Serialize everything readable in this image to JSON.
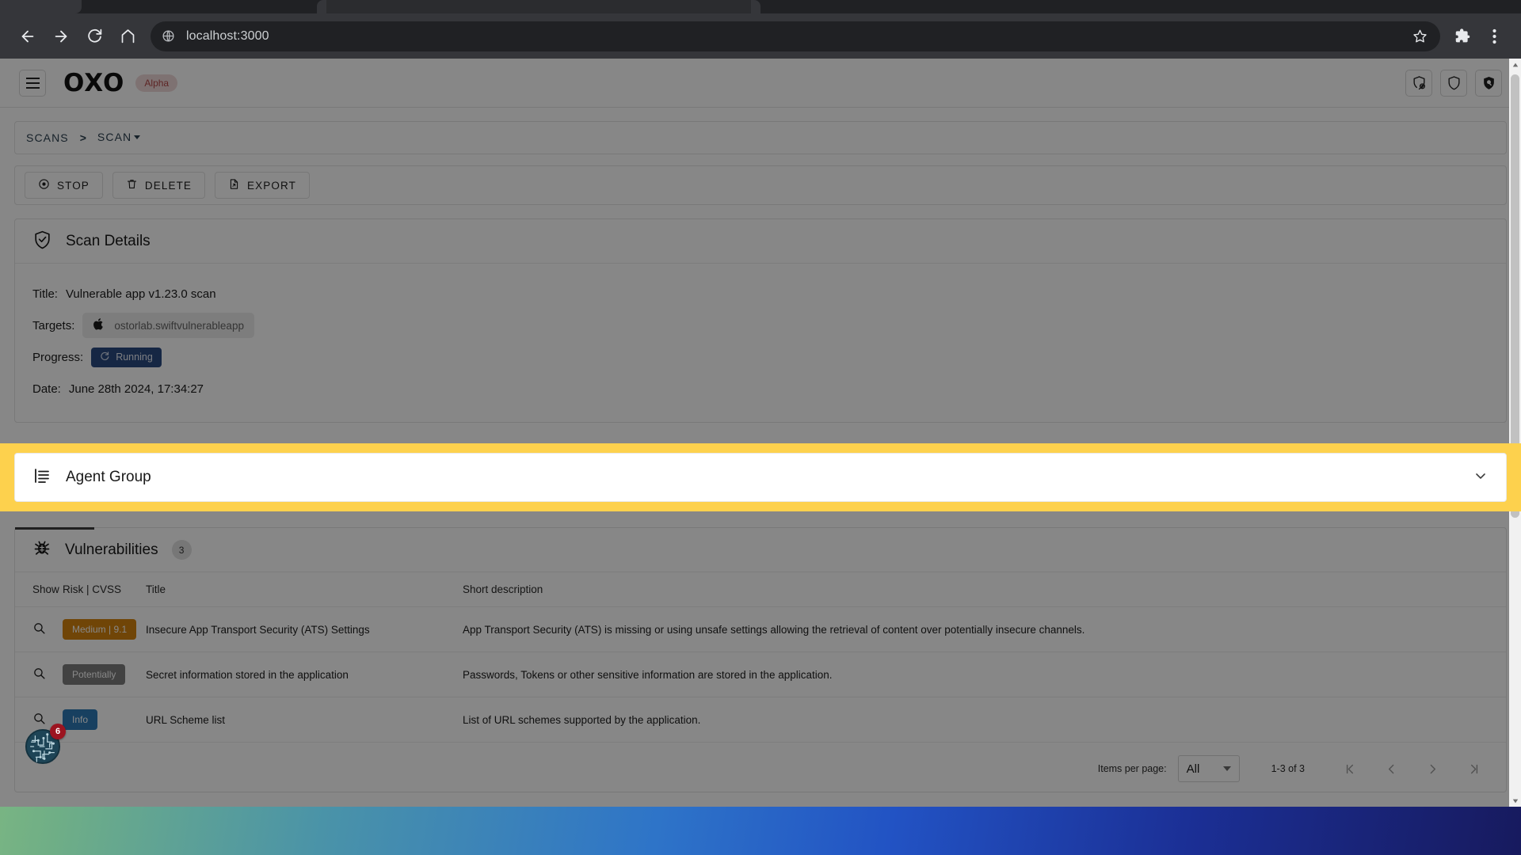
{
  "browser": {
    "url": "localhost:3000",
    "back_label": "Back",
    "forward_label": "Forward",
    "reload_label": "Reload",
    "home_label": "Home",
    "bookmark_label": "Bookmark this tab",
    "extensions_label": "Extensions",
    "menu_label": "Customize and control Google Chrome"
  },
  "app": {
    "brand": "OXO",
    "version_chip": "Alpha",
    "header_icons": [
      "shield-plus-icon",
      "shield-icon",
      "shield-search-icon"
    ]
  },
  "breadcrumb": {
    "root": "SCANS",
    "separator": ">",
    "current": "SCAN"
  },
  "actions": [
    {
      "label": "STOP",
      "icon": "stop-circle-icon"
    },
    {
      "label": "DELETE",
      "icon": "trash-icon"
    },
    {
      "label": "EXPORT",
      "icon": "file-export-icon"
    }
  ],
  "scan_details": {
    "heading": "Scan Details",
    "icon": "shield-check-icon",
    "title_label": "Title:",
    "title_value": "Vulnerable app v1.23.0 scan",
    "targets_label": "Targets:",
    "target_value": "ostorlab.swiftvulnerableapp",
    "target_icon": "apple-icon",
    "progress_label": "Progress:",
    "progress_value": "Running",
    "progress_color": "#2b4a80",
    "date_label": "Date:",
    "date_value": "June 28th 2024, 17:34:27"
  },
  "agent_group": {
    "heading": "Agent Group",
    "icon": "list-lines-icon",
    "expand_icon": "chevron-down-icon",
    "highlight_color": "#fdd14d"
  },
  "vulnerabilities": {
    "heading": "Vulnerabilities",
    "icon": "bug-icon",
    "count": "3",
    "columns": [
      "Show",
      "Risk | CVSS",
      "Title",
      "Short description"
    ],
    "rows": [
      {
        "show_icon": "magnifier-icon",
        "risk": "Medium  |  9.1",
        "risk_color": "#d3830f",
        "title": "Insecure App Transport Security (ATS) Settings",
        "description": "App Transport Security (ATS) is missing or using unsafe settings allowing the retrieval of content over potentially insecure channels."
      },
      {
        "show_icon": "magnifier-icon",
        "risk": "Potentially",
        "risk_color": "#7d7d7d",
        "title": "Secret information stored in the application",
        "description": "Passwords, Tokens or other sensitive information are stored in the application."
      },
      {
        "show_icon": "magnifier-icon",
        "risk": "Info",
        "risk_color": "#2f7ab5",
        "title": "URL Scheme list",
        "description": "List of URL schemes supported by the application."
      }
    ],
    "paginator": {
      "items_per_page_label": "Items per page:",
      "items_per_page_value": "All",
      "range_label": "1-3 of 3",
      "first_icon": "first-page-icon",
      "prev_icon": "prev-page-icon",
      "next_icon": "next-page-icon",
      "last_icon": "last-page-icon"
    }
  },
  "dock": {
    "app_icon": "circuit-app-icon",
    "badge_count": "6"
  }
}
